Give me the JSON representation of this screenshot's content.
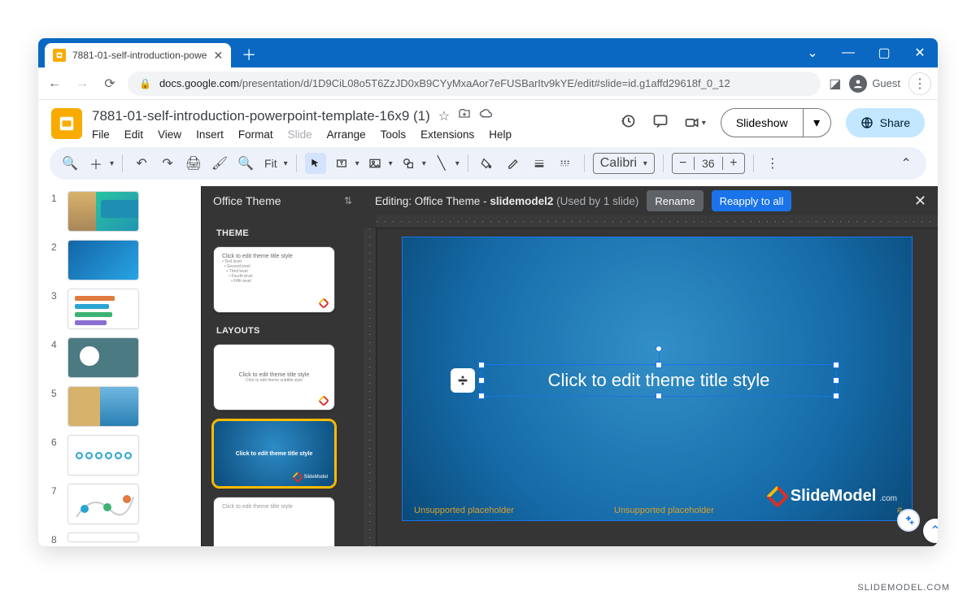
{
  "browser": {
    "tab_title": "7881-01-self-introduction-powe",
    "url_host": "docs.google.com",
    "url_path": "/presentation/d/1D9CiL08o5T6ZzJD0xB9CYyMxaAor7eFUSBarItv9kYE/edit#slide=id.g1affd29618f_0_12",
    "guest_label": "Guest"
  },
  "doc": {
    "title": "7881-01-self-introduction-powerpoint-template-16x9 (1)"
  },
  "menu": {
    "file": "File",
    "edit": "Edit",
    "view": "View",
    "insert": "Insert",
    "format": "Format",
    "slide": "Slide",
    "arrange": "Arrange",
    "tools": "Tools",
    "extensions": "Extensions",
    "help": "Help"
  },
  "header_actions": {
    "slideshow": "Slideshow",
    "share": "Share"
  },
  "toolbar": {
    "zoom_label": "Fit",
    "font_name": "Calibri",
    "font_size": "36"
  },
  "filmstrip_numbers": [
    "1",
    "2",
    "3",
    "4",
    "5",
    "6",
    "7",
    "8"
  ],
  "theme_panel": {
    "title": "Office Theme",
    "section_theme": "THEME",
    "section_layouts": "LAYOUTS",
    "master_title_line": "Click to edit theme title style",
    "layout1_title": "Click to edit theme title style",
    "layout1_sub": "Click to edit theme subtitle style",
    "layout2_title": "Click to edit theme title style",
    "logo_text": "SlideModel"
  },
  "canvas": {
    "banner_prefix": "Editing: Office Theme - ",
    "banner_layout": "slidemodel2",
    "banner_used": "(Used by 1 slide)",
    "rename": "Rename",
    "reapply": "Reapply to all",
    "placeholder_text": "Click to edit theme title style",
    "unsupported": "Unsupported placeholder",
    "hash": "#",
    "logo_text": "SlideModel",
    "logo_suffix": ".com"
  },
  "watermark": "SLIDEMODEL.COM"
}
